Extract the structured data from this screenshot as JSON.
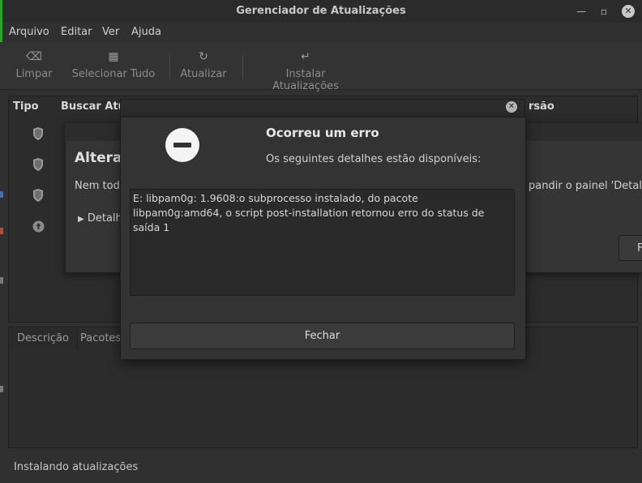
{
  "window": {
    "title": "Gerenciador de Atualizações"
  },
  "menu": [
    "Arquivo",
    "Editar",
    "Ver",
    "Ajuda"
  ],
  "toolbar": {
    "clear": "Limpar",
    "select_all": "Selecionar Tudo",
    "refresh": "Atualizar",
    "install": "Instalar Atualizações"
  },
  "list": {
    "col_type": "Tipo",
    "col_search": "Buscar Atua",
    "col_version": "rsão"
  },
  "tabs": {
    "description": "Descrição",
    "packages": "Pacotes"
  },
  "status": "Instalando atualizações",
  "changes_dialog": {
    "title": "Alteraç",
    "text": "Nem toda",
    "text_right": "pandir o painel 'Detalhe",
    "details": "Detalh",
    "button": "F"
  },
  "error_dialog": {
    "title": "Ocorreu um erro",
    "subtitle": "Os seguintes detalhes estão disponíveis:",
    "message": "E: libpam0g: 1.9608:o subprocesso instalado, do pacote libpam0g:amd64, o script post-installation retornou erro do status de saída 1",
    "close": "Fechar"
  },
  "colors": {
    "accent_green": "#29a329",
    "background": "#303030"
  }
}
